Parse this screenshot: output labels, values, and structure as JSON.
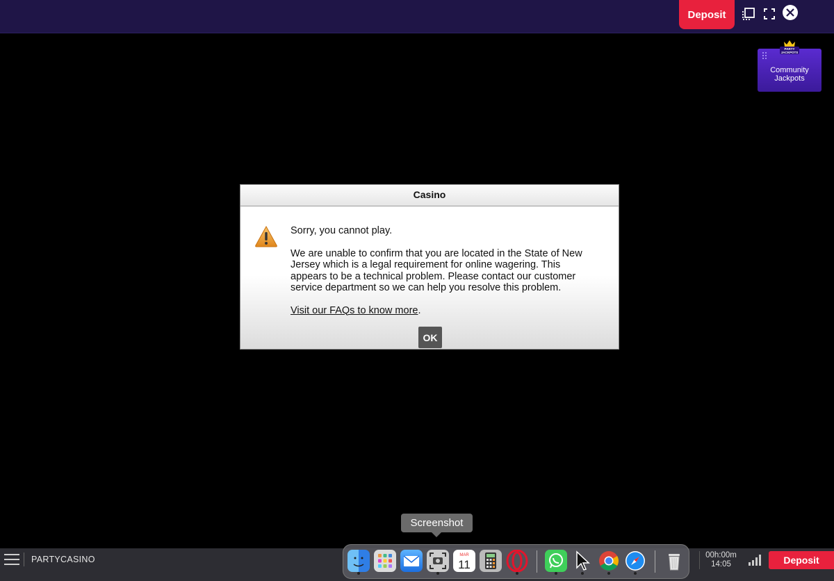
{
  "topbar": {
    "deposit_label": "Deposit"
  },
  "jackpots": {
    "logo_text": "PARTY JACKPOTS",
    "label": "Community Jackpots"
  },
  "dialog": {
    "title": "Casino",
    "line1": "Sorry, you cannot play.",
    "body": "We are unable to confirm that you are located in the State of New Jersey which is a legal requirement for online wagering. This appears to be a technical problem. Please contact our customer service department so we can help you resolve this problem.",
    "faq_link": "Visit our FAQs to know more",
    "faq_suffix": ".",
    "ok_label": "OK"
  },
  "tooltip": {
    "label": "Screenshot"
  },
  "bottombar": {
    "brand": "PARTYCASINO",
    "timer": "00h:00m",
    "clock": "14:05",
    "deposit_label": "Deposit"
  },
  "calendar": {
    "month": "MAR",
    "day": "11"
  },
  "dock_icons": [
    "finder-icon",
    "launchpad-icon",
    "mail-icon",
    "screenshot-icon",
    "calendar-icon",
    "calculator-icon",
    "opera-icon",
    "whatsapp-icon",
    "cursor-icon",
    "chrome-icon",
    "safari-icon",
    "trash-icon"
  ],
  "colors": {
    "brand_purple": "#1f1547",
    "deposit_red": "#e8213d",
    "jackpot_purple": "#4a22b8"
  }
}
